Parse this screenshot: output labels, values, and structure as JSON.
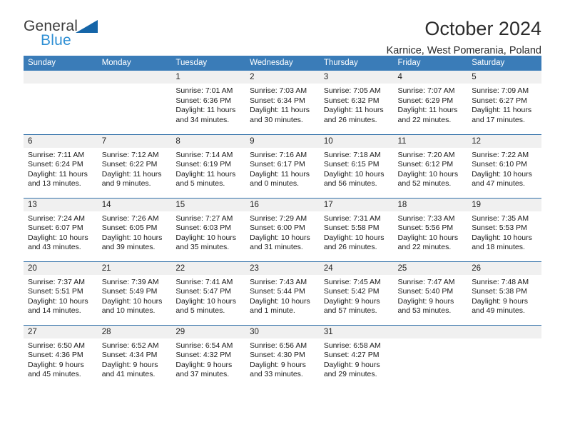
{
  "brand": {
    "name_top": "General",
    "name_bottom": "Blue",
    "triangle_color": "#1565a8",
    "blue_text_color": "#2e8fd4"
  },
  "header": {
    "title": "October 2024",
    "subtitle": "Karnice, West Pomerania, Poland",
    "header_bg": "#3a7cb8",
    "daynum_bg": "#f0f0f0",
    "week_rule_color": "#2f6fa8"
  },
  "weekdays": [
    "Sunday",
    "Monday",
    "Tuesday",
    "Wednesday",
    "Thursday",
    "Friday",
    "Saturday"
  ],
  "weeks": [
    [
      {
        "day": "",
        "sunrise": "",
        "sunset": "",
        "daylight": ""
      },
      {
        "day": "",
        "sunrise": "",
        "sunset": "",
        "daylight": ""
      },
      {
        "day": "1",
        "sunrise": "Sunrise: 7:01 AM",
        "sunset": "Sunset: 6:36 PM",
        "daylight": "Daylight: 11 hours and 34 minutes."
      },
      {
        "day": "2",
        "sunrise": "Sunrise: 7:03 AM",
        "sunset": "Sunset: 6:34 PM",
        "daylight": "Daylight: 11 hours and 30 minutes."
      },
      {
        "day": "3",
        "sunrise": "Sunrise: 7:05 AM",
        "sunset": "Sunset: 6:32 PM",
        "daylight": "Daylight: 11 hours and 26 minutes."
      },
      {
        "day": "4",
        "sunrise": "Sunrise: 7:07 AM",
        "sunset": "Sunset: 6:29 PM",
        "daylight": "Daylight: 11 hours and 22 minutes."
      },
      {
        "day": "5",
        "sunrise": "Sunrise: 7:09 AM",
        "sunset": "Sunset: 6:27 PM",
        "daylight": "Daylight: 11 hours and 17 minutes."
      }
    ],
    [
      {
        "day": "6",
        "sunrise": "Sunrise: 7:11 AM",
        "sunset": "Sunset: 6:24 PM",
        "daylight": "Daylight: 11 hours and 13 minutes."
      },
      {
        "day": "7",
        "sunrise": "Sunrise: 7:12 AM",
        "sunset": "Sunset: 6:22 PM",
        "daylight": "Daylight: 11 hours and 9 minutes."
      },
      {
        "day": "8",
        "sunrise": "Sunrise: 7:14 AM",
        "sunset": "Sunset: 6:19 PM",
        "daylight": "Daylight: 11 hours and 5 minutes."
      },
      {
        "day": "9",
        "sunrise": "Sunrise: 7:16 AM",
        "sunset": "Sunset: 6:17 PM",
        "daylight": "Daylight: 11 hours and 0 minutes."
      },
      {
        "day": "10",
        "sunrise": "Sunrise: 7:18 AM",
        "sunset": "Sunset: 6:15 PM",
        "daylight": "Daylight: 10 hours and 56 minutes."
      },
      {
        "day": "11",
        "sunrise": "Sunrise: 7:20 AM",
        "sunset": "Sunset: 6:12 PM",
        "daylight": "Daylight: 10 hours and 52 minutes."
      },
      {
        "day": "12",
        "sunrise": "Sunrise: 7:22 AM",
        "sunset": "Sunset: 6:10 PM",
        "daylight": "Daylight: 10 hours and 47 minutes."
      }
    ],
    [
      {
        "day": "13",
        "sunrise": "Sunrise: 7:24 AM",
        "sunset": "Sunset: 6:07 PM",
        "daylight": "Daylight: 10 hours and 43 minutes."
      },
      {
        "day": "14",
        "sunrise": "Sunrise: 7:26 AM",
        "sunset": "Sunset: 6:05 PM",
        "daylight": "Daylight: 10 hours and 39 minutes."
      },
      {
        "day": "15",
        "sunrise": "Sunrise: 7:27 AM",
        "sunset": "Sunset: 6:03 PM",
        "daylight": "Daylight: 10 hours and 35 minutes."
      },
      {
        "day": "16",
        "sunrise": "Sunrise: 7:29 AM",
        "sunset": "Sunset: 6:00 PM",
        "daylight": "Daylight: 10 hours and 31 minutes."
      },
      {
        "day": "17",
        "sunrise": "Sunrise: 7:31 AM",
        "sunset": "Sunset: 5:58 PM",
        "daylight": "Daylight: 10 hours and 26 minutes."
      },
      {
        "day": "18",
        "sunrise": "Sunrise: 7:33 AM",
        "sunset": "Sunset: 5:56 PM",
        "daylight": "Daylight: 10 hours and 22 minutes."
      },
      {
        "day": "19",
        "sunrise": "Sunrise: 7:35 AM",
        "sunset": "Sunset: 5:53 PM",
        "daylight": "Daylight: 10 hours and 18 minutes."
      }
    ],
    [
      {
        "day": "20",
        "sunrise": "Sunrise: 7:37 AM",
        "sunset": "Sunset: 5:51 PM",
        "daylight": "Daylight: 10 hours and 14 minutes."
      },
      {
        "day": "21",
        "sunrise": "Sunrise: 7:39 AM",
        "sunset": "Sunset: 5:49 PM",
        "daylight": "Daylight: 10 hours and 10 minutes."
      },
      {
        "day": "22",
        "sunrise": "Sunrise: 7:41 AM",
        "sunset": "Sunset: 5:47 PM",
        "daylight": "Daylight: 10 hours and 5 minutes."
      },
      {
        "day": "23",
        "sunrise": "Sunrise: 7:43 AM",
        "sunset": "Sunset: 5:44 PM",
        "daylight": "Daylight: 10 hours and 1 minute."
      },
      {
        "day": "24",
        "sunrise": "Sunrise: 7:45 AM",
        "sunset": "Sunset: 5:42 PM",
        "daylight": "Daylight: 9 hours and 57 minutes."
      },
      {
        "day": "25",
        "sunrise": "Sunrise: 7:47 AM",
        "sunset": "Sunset: 5:40 PM",
        "daylight": "Daylight: 9 hours and 53 minutes."
      },
      {
        "day": "26",
        "sunrise": "Sunrise: 7:48 AM",
        "sunset": "Sunset: 5:38 PM",
        "daylight": "Daylight: 9 hours and 49 minutes."
      }
    ],
    [
      {
        "day": "27",
        "sunrise": "Sunrise: 6:50 AM",
        "sunset": "Sunset: 4:36 PM",
        "daylight": "Daylight: 9 hours and 45 minutes."
      },
      {
        "day": "28",
        "sunrise": "Sunrise: 6:52 AM",
        "sunset": "Sunset: 4:34 PM",
        "daylight": "Daylight: 9 hours and 41 minutes."
      },
      {
        "day": "29",
        "sunrise": "Sunrise: 6:54 AM",
        "sunset": "Sunset: 4:32 PM",
        "daylight": "Daylight: 9 hours and 37 minutes."
      },
      {
        "day": "30",
        "sunrise": "Sunrise: 6:56 AM",
        "sunset": "Sunset: 4:30 PM",
        "daylight": "Daylight: 9 hours and 33 minutes."
      },
      {
        "day": "31",
        "sunrise": "Sunrise: 6:58 AM",
        "sunset": "Sunset: 4:27 PM",
        "daylight": "Daylight: 9 hours and 29 minutes."
      },
      {
        "day": "",
        "sunrise": "",
        "sunset": "",
        "daylight": ""
      },
      {
        "day": "",
        "sunrise": "",
        "sunset": "",
        "daylight": ""
      }
    ]
  ]
}
